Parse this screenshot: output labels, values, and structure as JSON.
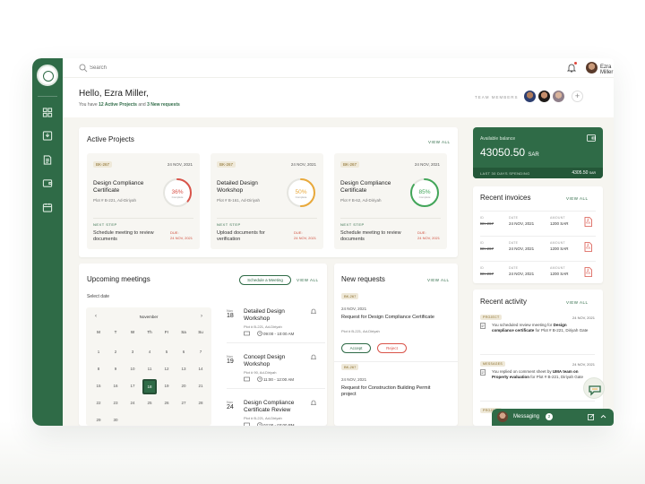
{
  "topbar": {
    "search_placeholder": "Search",
    "user_name": "Ezra Miller"
  },
  "hero": {
    "greeting": "Hello, Ezra Miller,",
    "sub_prefix": "You have",
    "sub_projects": "12 Active Projects",
    "sub_and": "and",
    "sub_requests": "3 New requests",
    "team_label": "TEAM MEMBERS"
  },
  "active_projects": {
    "title": "Active Projects",
    "view_all": "VIEW ALL",
    "next_step_label": "NEXT STEP",
    "items": [
      {
        "tag": "BK-267",
        "date": "24 NOV, 2021",
        "title": "Design Compliance Certificate",
        "address": "Plot # B-221, Ad-Diriyah",
        "percent": 36,
        "percent_label": "36%",
        "status": "Complete",
        "color": "#d9544a",
        "next": "Schedule meeting to review documents",
        "due_label": "DUE:",
        "due_date": "24 NOV, 2021"
      },
      {
        "tag": "BK-267",
        "date": "24 NOV, 2021",
        "title": "Detailed Design Workshop",
        "address": "Plot # B-161, Ad-Diriyah",
        "percent": 50,
        "percent_label": "50%",
        "status": "Complete",
        "color": "#e9a93b",
        "next": "Upload documents for verification",
        "due_label": "DUE:",
        "due_date": "24 NOV, 2021"
      },
      {
        "tag": "BK-267",
        "date": "24 NOV, 2021",
        "title": "Design Compliance Certificate",
        "address": "Plot # B-62, Ad-Diriyah",
        "percent": 85,
        "percent_label": "85%",
        "status": "Complete",
        "color": "#43a65a",
        "next": "Schedule meeting to review documents",
        "due_label": "DUE:",
        "due_date": "24 NOV, 2021"
      }
    ]
  },
  "balance": {
    "label": "Available balance",
    "amount": "43050.50",
    "currency": "SAR",
    "spending_label": "LAST 30 DAYS SPENDING",
    "spending_amount": "4305.50",
    "spending_currency": "SAR"
  },
  "invoices": {
    "title": "Recent invoices",
    "view_all": "VIEW ALL",
    "labels": {
      "id": "ID",
      "date": "DATE",
      "amount": "AMOUNT"
    },
    "rows": [
      {
        "id": "BK-267",
        "date": "24 NOV, 2021",
        "amount": "1200 SAR"
      },
      {
        "id": "BK-267",
        "date": "24 NOV, 2021",
        "amount": "1200 SAR"
      },
      {
        "id": "BK-267",
        "date": "24 NOV, 2021",
        "amount": "1200 SAR"
      }
    ]
  },
  "meetings": {
    "title": "Upcoming meetings",
    "schedule_button": "Schedule a Meeting",
    "view_all": "VIEW ALL",
    "select_date": "Select date",
    "calendar": {
      "month": "November",
      "weekdays": [
        "M",
        "T",
        "W",
        "Th",
        "Fr",
        "Sa",
        "Su"
      ],
      "days": [
        "1",
        "2",
        "3",
        "4",
        "5",
        "6",
        "7",
        "8",
        "9",
        "10",
        "11",
        "12",
        "13",
        "14",
        "15",
        "16",
        "17",
        "18",
        "19",
        "20",
        "21",
        "22",
        "23",
        "24",
        "25",
        "26",
        "27",
        "28",
        "29",
        "30"
      ],
      "selected": "18"
    },
    "items": [
      {
        "month": "Nov",
        "day": "18",
        "title": "Detailed Design Workshop",
        "address": "Plot # B-221, Ad-Diriyah",
        "time": "09:00 - 10:00 AM"
      },
      {
        "month": "Nov",
        "day": "19",
        "title": "Concept Design Workshop",
        "address": "Plot # 90, Ad-Diriyah",
        "time": "11:00 - 12:00 AM"
      },
      {
        "month": "Nov",
        "day": "24",
        "title": "Design Compliance Certificate Review",
        "address": "Plot # B-221, Ad-Diriyah",
        "time": "02:00 - 03:00 PM"
      }
    ]
  },
  "requests": {
    "title": "New requests",
    "view_all": "VIEW ALL",
    "accept": "Accept",
    "reject": "Reject",
    "items": [
      {
        "tag": "BK-267",
        "date": "24 NOV, 2021",
        "title": "Request for Design Compliance Certificate",
        "address": "Plot # B-221, Ad-Diriyah"
      },
      {
        "tag": "BK-267",
        "date": "24 NOV, 2021",
        "title": "Request for Construction Building Permit project",
        "address": ""
      }
    ]
  },
  "activity": {
    "title": "Recent activity",
    "view_all": "VIEW ALL",
    "items": [
      {
        "tag": "PROJECT",
        "date": "24 NOV, 2021",
        "pre": "You scheduled review meeting for",
        "bold": "Design compliance certificate",
        "post": "for Plot # B-221, Diriyah Gate"
      },
      {
        "tag": "MESSAGES",
        "date": "24 NOV, 2021",
        "pre": "You replied on comment sheet by",
        "bold": "UMA team on Property evaluation",
        "post": "for Plot # B-221, Diriyah Gate"
      },
      {
        "tag": "PROJECT",
        "date": "",
        "pre": "",
        "bold": "",
        "post": ""
      }
    ]
  },
  "messaging": {
    "label": "Messaging",
    "count": "2"
  },
  "colors": {
    "brand": "#2f6b47",
    "accent_red": "#d9544a",
    "accent_orange": "#e9a93b",
    "accent_green": "#43a65a"
  }
}
